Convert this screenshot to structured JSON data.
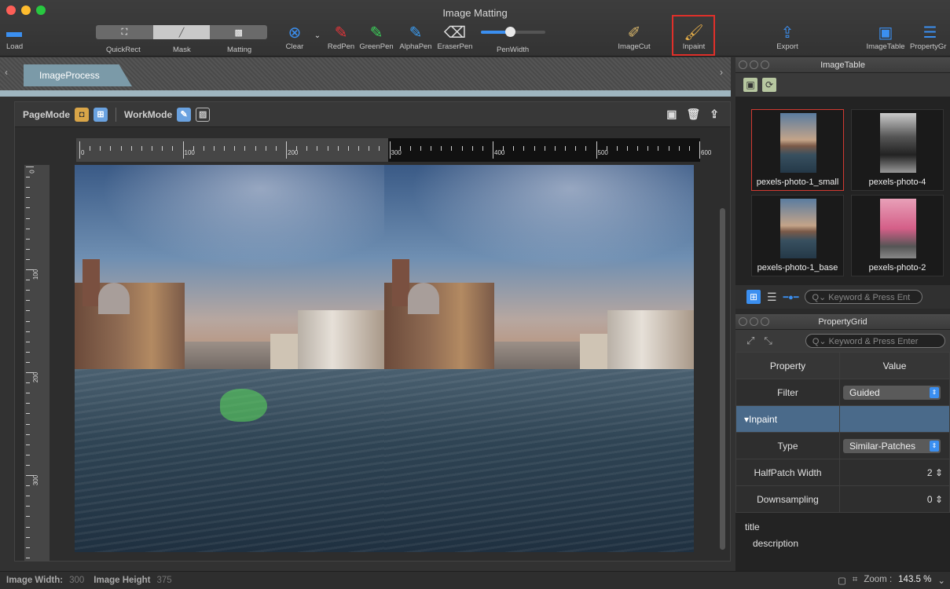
{
  "window": {
    "title": "Image Matting"
  },
  "colors": {
    "accent": "#3b8ff0",
    "highlight": "#e0302a",
    "mask": "#5adc5a"
  },
  "toolbar": {
    "load": "Load",
    "quickrect": "QuickRect",
    "mask": "Mask",
    "matting": "Matting",
    "clear": "Clear",
    "redpen": "RedPen",
    "greenpen": "GreenPen",
    "alphapen": "AlphaPen",
    "eraserpen": "EraserPen",
    "penwidth": "PenWidth",
    "imagecut": "ImageCut",
    "inpaint": "Inpaint",
    "export": "Export",
    "imagetable": "ImageTable",
    "propertygrid": "PropertyGr"
  },
  "tabs": {
    "imageprocess": "ImageProcess"
  },
  "modebar": {
    "pagemode": "PageMode",
    "workmode": "WorkMode"
  },
  "ruler": {
    "h": [
      "0",
      "100",
      "200",
      "300",
      "400",
      "500",
      "600"
    ],
    "v": [
      "0",
      "100",
      "200",
      "300"
    ]
  },
  "imagetable": {
    "title": "ImageTable",
    "items": [
      "pexels-photo-1_small",
      "pexels-photo-4",
      "pexels-photo-1_base",
      "pexels-photo-2"
    ],
    "search_placeholder": "Keyword & Press Ent"
  },
  "propertygrid": {
    "title": "PropertyGrid",
    "search_placeholder": "Keyword & Press Enter",
    "col_property": "Property",
    "col_value": "Value",
    "filter_label": "Filter",
    "filter_value": "Guided",
    "group": "Inpaint",
    "type_label": "Type",
    "type_value": "Similar-Patches",
    "halfpatch_label": "HalfPatch Width",
    "halfpatch_value": "2",
    "down_label": "Downsampling",
    "down_value": "0",
    "desc_title": "title",
    "desc_text": "description"
  },
  "status": {
    "width_label": "Image Width:",
    "width_value": "300",
    "height_label": "Image Height",
    "height_value": "375",
    "zoom_label": "Zoom :",
    "zoom_value": "143.5 %"
  }
}
